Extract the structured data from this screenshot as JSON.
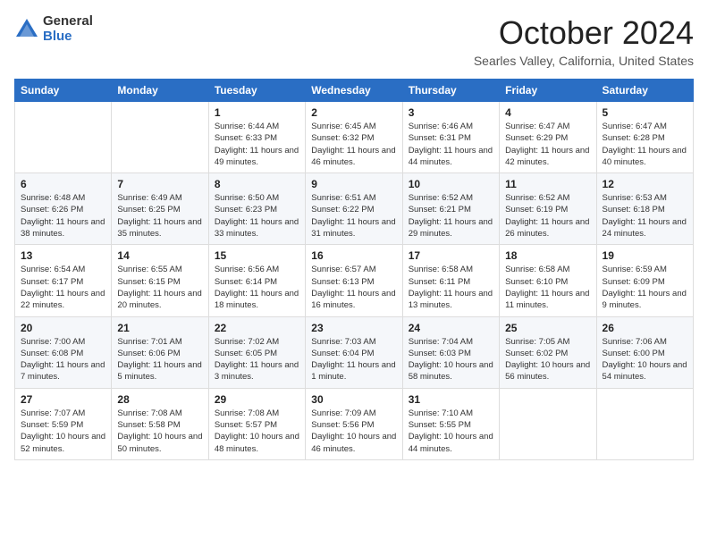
{
  "logo": {
    "general": "General",
    "blue": "Blue"
  },
  "title": "October 2024",
  "location": "Searles Valley, California, United States",
  "days_of_week": [
    "Sunday",
    "Monday",
    "Tuesday",
    "Wednesday",
    "Thursday",
    "Friday",
    "Saturday"
  ],
  "weeks": [
    [
      {
        "day": "",
        "info": ""
      },
      {
        "day": "",
        "info": ""
      },
      {
        "day": "1",
        "info": "Sunrise: 6:44 AM\nSunset: 6:33 PM\nDaylight: 11 hours and 49 minutes."
      },
      {
        "day": "2",
        "info": "Sunrise: 6:45 AM\nSunset: 6:32 PM\nDaylight: 11 hours and 46 minutes."
      },
      {
        "day": "3",
        "info": "Sunrise: 6:46 AM\nSunset: 6:31 PM\nDaylight: 11 hours and 44 minutes."
      },
      {
        "day": "4",
        "info": "Sunrise: 6:47 AM\nSunset: 6:29 PM\nDaylight: 11 hours and 42 minutes."
      },
      {
        "day": "5",
        "info": "Sunrise: 6:47 AM\nSunset: 6:28 PM\nDaylight: 11 hours and 40 minutes."
      }
    ],
    [
      {
        "day": "6",
        "info": "Sunrise: 6:48 AM\nSunset: 6:26 PM\nDaylight: 11 hours and 38 minutes."
      },
      {
        "day": "7",
        "info": "Sunrise: 6:49 AM\nSunset: 6:25 PM\nDaylight: 11 hours and 35 minutes."
      },
      {
        "day": "8",
        "info": "Sunrise: 6:50 AM\nSunset: 6:23 PM\nDaylight: 11 hours and 33 minutes."
      },
      {
        "day": "9",
        "info": "Sunrise: 6:51 AM\nSunset: 6:22 PM\nDaylight: 11 hours and 31 minutes."
      },
      {
        "day": "10",
        "info": "Sunrise: 6:52 AM\nSunset: 6:21 PM\nDaylight: 11 hours and 29 minutes."
      },
      {
        "day": "11",
        "info": "Sunrise: 6:52 AM\nSunset: 6:19 PM\nDaylight: 11 hours and 26 minutes."
      },
      {
        "day": "12",
        "info": "Sunrise: 6:53 AM\nSunset: 6:18 PM\nDaylight: 11 hours and 24 minutes."
      }
    ],
    [
      {
        "day": "13",
        "info": "Sunrise: 6:54 AM\nSunset: 6:17 PM\nDaylight: 11 hours and 22 minutes."
      },
      {
        "day": "14",
        "info": "Sunrise: 6:55 AM\nSunset: 6:15 PM\nDaylight: 11 hours and 20 minutes."
      },
      {
        "day": "15",
        "info": "Sunrise: 6:56 AM\nSunset: 6:14 PM\nDaylight: 11 hours and 18 minutes."
      },
      {
        "day": "16",
        "info": "Sunrise: 6:57 AM\nSunset: 6:13 PM\nDaylight: 11 hours and 16 minutes."
      },
      {
        "day": "17",
        "info": "Sunrise: 6:58 AM\nSunset: 6:11 PM\nDaylight: 11 hours and 13 minutes."
      },
      {
        "day": "18",
        "info": "Sunrise: 6:58 AM\nSunset: 6:10 PM\nDaylight: 11 hours and 11 minutes."
      },
      {
        "day": "19",
        "info": "Sunrise: 6:59 AM\nSunset: 6:09 PM\nDaylight: 11 hours and 9 minutes."
      }
    ],
    [
      {
        "day": "20",
        "info": "Sunrise: 7:00 AM\nSunset: 6:08 PM\nDaylight: 11 hours and 7 minutes."
      },
      {
        "day": "21",
        "info": "Sunrise: 7:01 AM\nSunset: 6:06 PM\nDaylight: 11 hours and 5 minutes."
      },
      {
        "day": "22",
        "info": "Sunrise: 7:02 AM\nSunset: 6:05 PM\nDaylight: 11 hours and 3 minutes."
      },
      {
        "day": "23",
        "info": "Sunrise: 7:03 AM\nSunset: 6:04 PM\nDaylight: 11 hours and 1 minute."
      },
      {
        "day": "24",
        "info": "Sunrise: 7:04 AM\nSunset: 6:03 PM\nDaylight: 10 hours and 58 minutes."
      },
      {
        "day": "25",
        "info": "Sunrise: 7:05 AM\nSunset: 6:02 PM\nDaylight: 10 hours and 56 minutes."
      },
      {
        "day": "26",
        "info": "Sunrise: 7:06 AM\nSunset: 6:00 PM\nDaylight: 10 hours and 54 minutes."
      }
    ],
    [
      {
        "day": "27",
        "info": "Sunrise: 7:07 AM\nSunset: 5:59 PM\nDaylight: 10 hours and 52 minutes."
      },
      {
        "day": "28",
        "info": "Sunrise: 7:08 AM\nSunset: 5:58 PM\nDaylight: 10 hours and 50 minutes."
      },
      {
        "day": "29",
        "info": "Sunrise: 7:08 AM\nSunset: 5:57 PM\nDaylight: 10 hours and 48 minutes."
      },
      {
        "day": "30",
        "info": "Sunrise: 7:09 AM\nSunset: 5:56 PM\nDaylight: 10 hours and 46 minutes."
      },
      {
        "day": "31",
        "info": "Sunrise: 7:10 AM\nSunset: 5:55 PM\nDaylight: 10 hours and 44 minutes."
      },
      {
        "day": "",
        "info": ""
      },
      {
        "day": "",
        "info": ""
      }
    ]
  ]
}
